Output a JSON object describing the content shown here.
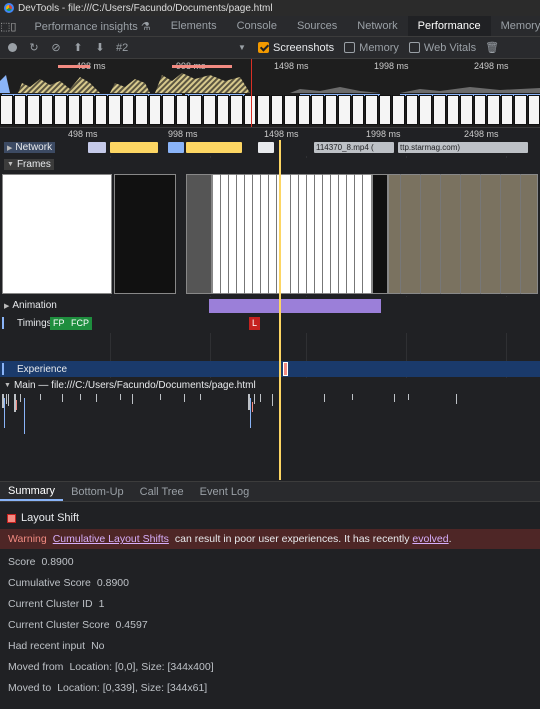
{
  "window": {
    "title": "DevTools - file:///C:/Users/Facundo/Documents/page.html"
  },
  "tabs": [
    {
      "label": "Performance insights ⚗"
    },
    {
      "label": "Elements"
    },
    {
      "label": "Console"
    },
    {
      "label": "Sources"
    },
    {
      "label": "Network"
    },
    {
      "label": "Performance"
    },
    {
      "label": "Memory"
    }
  ],
  "toolbar": {
    "profile": "#2",
    "screenshots": "Screenshots",
    "memory": "Memory",
    "web_vitals": "Web Vitals"
  },
  "overview": {
    "ticks": [
      "498 ms",
      "998 ms",
      "1498 ms",
      "1998 ms",
      "2498 ms"
    ]
  },
  "ruler": {
    "ticks": [
      "498 ms",
      "998 ms",
      "1498 ms",
      "1998 ms",
      "2498 ms"
    ]
  },
  "tracks": {
    "network": "Network",
    "network_item1": "114370_8.mp4 (",
    "network_item2": "ttp.starmag.com)",
    "frames": "Frames",
    "animation": "Animation",
    "timings": "Timings",
    "fp": "FP",
    "fcp": "FCP",
    "l": "L",
    "experience": "Experience",
    "main": "Main — file:///C:/Users/Facundo/Documents/page.html"
  },
  "bottom_tabs": [
    {
      "label": "Summary"
    },
    {
      "label": "Bottom-Up"
    },
    {
      "label": "Call Tree"
    },
    {
      "label": "Event Log"
    }
  ],
  "summary": {
    "title": "Layout Shift",
    "warning_label": "Warning",
    "warning_link": "Cumulative Layout Shifts",
    "warning_text": "can result in poor user experiences. It has recently",
    "warning_link2": "evolved",
    "warning_end": ".",
    "rows": [
      {
        "label": "Score",
        "value": "0.8900"
      },
      {
        "label": "Cumulative Score",
        "value": "0.8900"
      },
      {
        "label": "Current Cluster ID",
        "value": "1"
      },
      {
        "label": "Current Cluster Score",
        "value": "0.4597"
      },
      {
        "label": "Had recent input",
        "value": "No"
      },
      {
        "label": "Moved from",
        "value": "Location: [0,0], Size: [344x400]"
      },
      {
        "label": "Moved to",
        "value": "Location: [0,339], Size: [344x61]"
      }
    ]
  },
  "colors": {
    "accent": "#f29900",
    "selection": "#8ab4f8",
    "warning_bg": "#4e2626",
    "playhead": "#fdd663"
  }
}
